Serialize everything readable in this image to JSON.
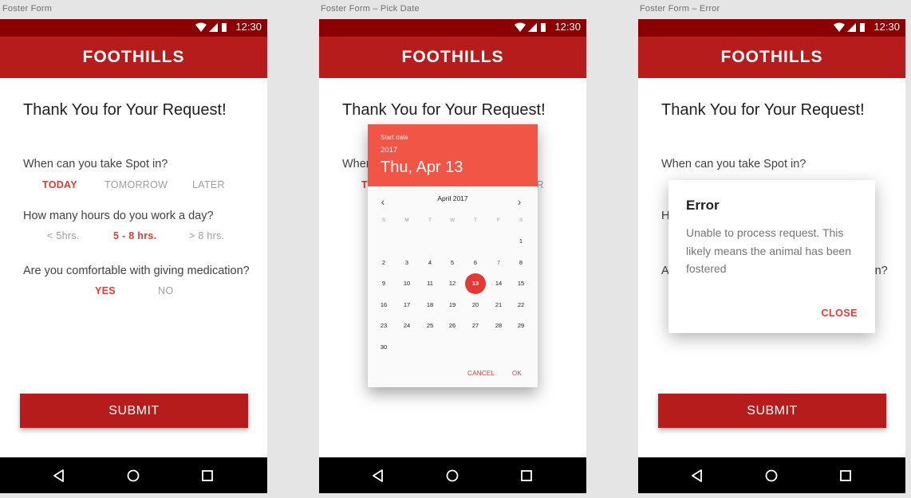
{
  "labels": [
    "Foster Form",
    "Foster Form – Pick Date",
    "Foster Form – Error"
  ],
  "status": {
    "time": "12:30"
  },
  "app": {
    "title": "FOOTHILLS"
  },
  "form": {
    "title": "Thank You for Your Request!",
    "q1": "When can you take Spot in?",
    "q1_options": [
      "TODAY",
      "TOMORROW",
      "LATER"
    ],
    "q1_selected": "TODAY",
    "q2": "How many hours do you work a day?",
    "q2_options": [
      "< 5hrs.",
      "5 - 8 hrs.",
      "> 8 hrs."
    ],
    "q2_selected": "5 - 8 hrs.",
    "q3": "Are you comfortable with giving medication?",
    "q3_options": [
      "YES",
      "NO"
    ],
    "q3_selected": "YES",
    "submit": "SUBMIT"
  },
  "picker": {
    "label": "Start date",
    "year": "2017",
    "date": "Thu, Apr 13",
    "month": "April 2017",
    "weekdays": [
      "S",
      "M",
      "T",
      "W",
      "T",
      "F",
      "S"
    ],
    "days": [
      "1",
      "2",
      "3",
      "4",
      "5",
      "6",
      "7",
      "8",
      "9",
      "10",
      "11",
      "12",
      "13",
      "14",
      "15",
      "16",
      "17",
      "18",
      "19",
      "20",
      "21",
      "22",
      "23",
      "24",
      "25",
      "26",
      "27",
      "28",
      "29",
      "30"
    ],
    "first_weekday_index": 6,
    "selected_day": "13",
    "highlight_day": "7",
    "cancel": "CANCEL",
    "ok": "OK"
  },
  "error": {
    "title": "Error",
    "message": "Unable to process request. This likely means the animal has been fostered",
    "close": "CLOSE"
  },
  "colors": {
    "status": "#8b0000",
    "appbar": "#b71c1c",
    "accent": "#e53935",
    "picker_header": "#f05545"
  },
  "icons": [
    "wifi-icon",
    "signal-icon",
    "battery-icon",
    "back-icon",
    "home-icon",
    "recents-icon",
    "chevron-left-icon",
    "chevron-right-icon"
  ]
}
